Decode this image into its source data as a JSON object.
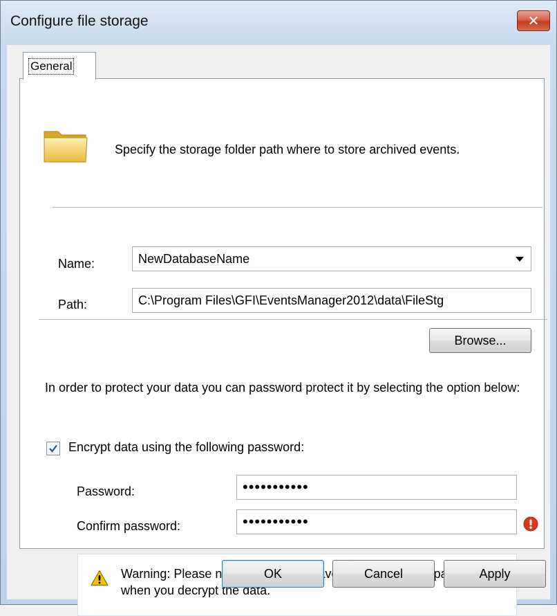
{
  "window": {
    "title": "Configure file storage",
    "close_glyph": "✕"
  },
  "tabs": [
    {
      "label": "General",
      "selected": true
    }
  ],
  "general": {
    "intro_text": "Specify the storage folder path where to store archived events.",
    "name_label": "Name:",
    "name_value": "NewDatabaseName",
    "path_label": "Path:",
    "path_value": "C:\\Program Files\\GFI\\EventsManager2012\\data\\FileStg",
    "browse_label": "Browse...",
    "protect_text": "In order to protect your data you can password protect it by selecting the option below:",
    "encrypt_label": "Encrypt data using the following password:",
    "encrypt_checked": true,
    "password_label": "Password:",
    "password_value": "•••••••••••",
    "confirm_label": "Confirm password:",
    "confirm_value": "•••••••••••",
    "warning_text": "Warning: Please note that you will have to use the same password when you decrypt the data."
  },
  "buttons": {
    "ok": "OK",
    "cancel": "Cancel",
    "apply": "Apply"
  },
  "icons": {
    "folder": "folder-icon",
    "error": "error-icon",
    "warning": "warning-icon",
    "checkmark": "checkmark-icon",
    "dropdown": "chevron-down-icon"
  },
  "colors": {
    "close_button": "#c9472a",
    "error_icon": "#d9381e",
    "warning_icon": "#f5c400",
    "ok_button_border": "#3c7fb1"
  }
}
